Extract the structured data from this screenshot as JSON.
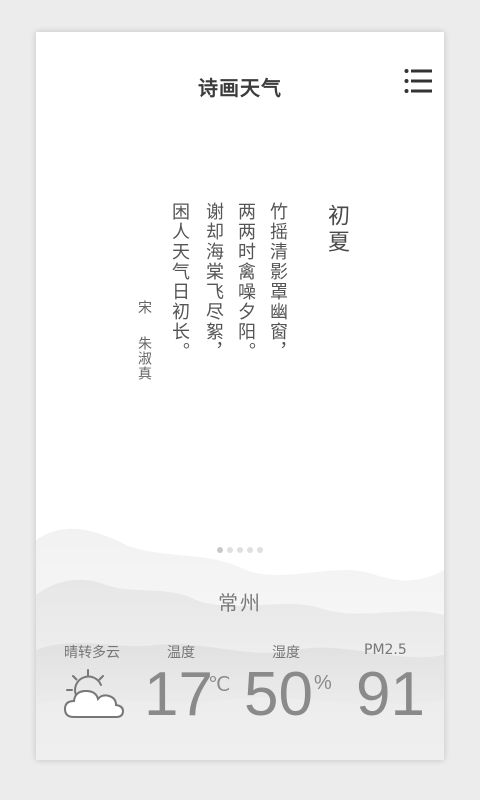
{
  "header": {
    "title": "诗画天气"
  },
  "icons": {
    "menu": "list-menu-icon",
    "weather": "partly-cloudy-icon"
  },
  "poem": {
    "title": "初夏",
    "lines": [
      "竹摇清影罩幽窗，",
      "两两时禽噪夕阳。",
      "谢却海棠飞尽絮，",
      "困人天气日初长。"
    ],
    "dynasty": "宋",
    "author": "朱淑真"
  },
  "pager": {
    "count": 5,
    "active": 0
  },
  "weather": {
    "city": "常州",
    "condition": "晴转多云",
    "temp_label": "温度",
    "temp_value": "17",
    "temp_unit": "℃",
    "humidity_label": "湿度",
    "humidity_value": "50",
    "humidity_unit": "%",
    "pm_label": "PM2.5",
    "pm_value": "91"
  }
}
